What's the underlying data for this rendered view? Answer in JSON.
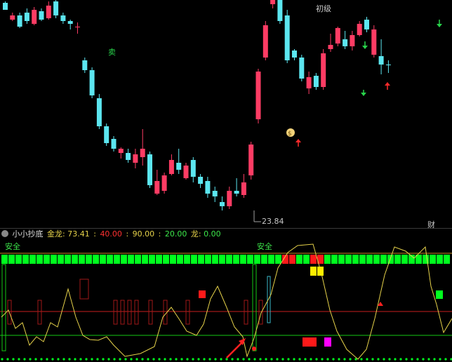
{
  "colors": {
    "up": "#ff3c64",
    "down": "#5ce6f0",
    "sell_marker": "#28d24a",
    "buy_marker": "#ff2a2a",
    "price_label": "#a0a0a0",
    "bar_green": "#00ff1e",
    "bar_red": "#ff1a1a",
    "bar_yellow": "#ffee00",
    "bar_magenta": "#ff00ff",
    "line_yellow": "#e6d24a",
    "line_red": "#c81e1e",
    "line_green": "#14c814"
  },
  "main_chart": {
    "labels": {
      "sell": "卖",
      "initial": "初级",
      "low_price": "23.84",
      "finance": "财"
    },
    "candles": [
      {
        "o": 4,
        "c": 14,
        "h": 2,
        "l": 14,
        "dir": "down"
      },
      {
        "o": 28,
        "c": 22,
        "h": 18,
        "l": 30,
        "dir": "up"
      },
      {
        "o": 22,
        "c": 38,
        "h": 18,
        "l": 40,
        "dir": "down"
      },
      {
        "o": 18,
        "c": 30,
        "h": 12,
        "l": 34,
        "dir": "down"
      },
      {
        "o": 34,
        "c": 14,
        "h": 10,
        "l": 36,
        "dir": "up"
      },
      {
        "o": 16,
        "c": 28,
        "h": 12,
        "l": 30,
        "dir": "down"
      },
      {
        "o": 26,
        "c": 8,
        "h": 2,
        "l": 28,
        "dir": "up"
      },
      {
        "o": 2,
        "c": 22,
        "h": 0,
        "l": 26,
        "dir": "down"
      },
      {
        "o": 22,
        "c": 30,
        "h": 18,
        "l": 34,
        "dir": "down"
      },
      {
        "o": 30,
        "c": 34,
        "h": 28,
        "l": 42,
        "dir": "down"
      },
      {
        "o": 38,
        "c": 38,
        "h": 32,
        "l": 48,
        "dir": "up"
      },
      {
        "o": 86,
        "c": 100,
        "h": 82,
        "l": 104,
        "dir": "down"
      },
      {
        "o": 100,
        "c": 136,
        "h": 96,
        "l": 140,
        "dir": "down"
      },
      {
        "o": 140,
        "c": 180,
        "h": 134,
        "l": 184,
        "dir": "down"
      },
      {
        "o": 180,
        "c": 204,
        "h": 176,
        "l": 208,
        "dir": "down"
      },
      {
        "o": 198,
        "c": 212,
        "h": 194,
        "l": 216,
        "dir": "down"
      },
      {
        "o": 212,
        "c": 218,
        "h": 210,
        "l": 226,
        "dir": "up"
      },
      {
        "o": 218,
        "c": 228,
        "h": 212,
        "l": 232,
        "dir": "down"
      },
      {
        "o": 232,
        "c": 220,
        "h": 212,
        "l": 240,
        "dir": "up"
      },
      {
        "o": 224,
        "c": 212,
        "h": 184,
        "l": 236,
        "dir": "up"
      },
      {
        "o": 220,
        "c": 264,
        "h": 216,
        "l": 268,
        "dir": "down"
      },
      {
        "o": 276,
        "c": 258,
        "h": 242,
        "l": 278,
        "dir": "up"
      },
      {
        "o": 272,
        "c": 250,
        "h": 246,
        "l": 276,
        "dir": "up"
      },
      {
        "o": 248,
        "c": 228,
        "h": 220,
        "l": 250,
        "dir": "up"
      },
      {
        "o": 232,
        "c": 242,
        "h": 212,
        "l": 248,
        "dir": "down"
      },
      {
        "o": 254,
        "c": 236,
        "h": 232,
        "l": 256,
        "dir": "up"
      },
      {
        "o": 228,
        "c": 252,
        "h": 224,
        "l": 260,
        "dir": "down"
      },
      {
        "o": 252,
        "c": 262,
        "h": 248,
        "l": 268,
        "dir": "down"
      },
      {
        "o": 258,
        "c": 276,
        "h": 252,
        "l": 282,
        "dir": "down"
      },
      {
        "o": 272,
        "c": 280,
        "h": 266,
        "l": 288,
        "dir": "down"
      },
      {
        "o": 288,
        "c": 294,
        "h": 280,
        "l": 300,
        "dir": "down"
      },
      {
        "o": 294,
        "c": 272,
        "h": 266,
        "l": 298,
        "dir": "up"
      },
      {
        "o": 272,
        "c": 276,
        "h": 254,
        "l": 280,
        "dir": "down"
      },
      {
        "o": 278,
        "c": 260,
        "h": 248,
        "l": 282,
        "dir": "up"
      },
      {
        "o": 250,
        "c": 206,
        "h": 202,
        "l": 256,
        "dir": "up"
      },
      {
        "o": 170,
        "c": 102,
        "h": 98,
        "l": 176,
        "dir": "up"
      },
      {
        "o": 82,
        "c": 36,
        "h": 30,
        "l": 86,
        "dir": "up"
      },
      {
        "o": 6,
        "c": 0,
        "h": 0,
        "l": 12,
        "dir": "up"
      },
      {
        "o": 0,
        "c": 30,
        "h": 0,
        "l": 34,
        "dir": "down"
      },
      {
        "o": 22,
        "c": 86,
        "h": 14,
        "l": 90,
        "dir": "down"
      },
      {
        "o": 72,
        "c": 82,
        "h": 70,
        "l": 86,
        "dir": "down"
      },
      {
        "o": 82,
        "c": 112,
        "h": 78,
        "l": 116,
        "dir": "down"
      },
      {
        "o": 126,
        "c": 110,
        "h": 102,
        "l": 134,
        "dir": "up"
      },
      {
        "o": 108,
        "c": 124,
        "h": 104,
        "l": 128,
        "dir": "down"
      },
      {
        "o": 124,
        "c": 76,
        "h": 70,
        "l": 128,
        "dir": "up"
      },
      {
        "o": 70,
        "c": 64,
        "h": 48,
        "l": 74,
        "dir": "up"
      },
      {
        "o": 62,
        "c": 40,
        "h": 38,
        "l": 66,
        "dir": "up"
      },
      {
        "o": 56,
        "c": 66,
        "h": 44,
        "l": 70,
        "dir": "down"
      },
      {
        "o": 66,
        "c": 50,
        "h": 44,
        "l": 72,
        "dir": "up"
      },
      {
        "o": 50,
        "c": 34,
        "h": 30,
        "l": 52,
        "dir": "up"
      },
      {
        "o": 28,
        "c": 42,
        "h": 24,
        "l": 46,
        "dir": "down"
      },
      {
        "o": 42,
        "c": 78,
        "h": 36,
        "l": 82,
        "dir": "up"
      },
      {
        "o": 80,
        "c": 92,
        "h": 56,
        "l": 106,
        "dir": "down"
      },
      {
        "o": 92,
        "c": 92,
        "h": 86,
        "l": 104,
        "dir": "down"
      }
    ]
  },
  "indicator": {
    "name": "小小抄底",
    "gold_dragon_label": "金龙:",
    "gold_dragon_value": "73.41",
    "level1": "40.00",
    "level2": "90.00",
    "level3": "20.00",
    "dragon_label": "龙:",
    "dragon_value": "0.00",
    "safe_label_1": "安全",
    "safe_label_2": "安全"
  }
}
